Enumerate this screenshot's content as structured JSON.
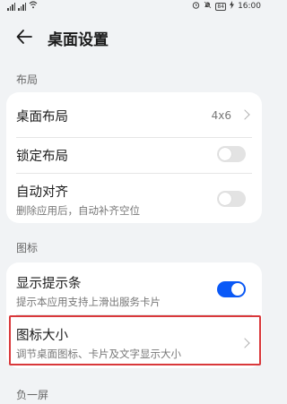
{
  "status_bar": {
    "time": "16:00",
    "battery": "84"
  },
  "header": {
    "title": "桌面设置"
  },
  "sections": {
    "layout": {
      "label": "布局",
      "items": [
        {
          "title": "桌面布局",
          "value": "4x6"
        },
        {
          "title": "锁定布局",
          "toggle": false
        },
        {
          "title": "自动对齐",
          "subtitle": "删除应用后，自动补齐空位",
          "toggle": false
        }
      ]
    },
    "icons": {
      "label": "图标",
      "items": [
        {
          "title": "显示提示条",
          "subtitle": "提示本应用支持上滑出服务卡片",
          "toggle": true
        },
        {
          "title": "图标大小",
          "subtitle": "调节桌面图标、卡片及文字显示大小"
        }
      ]
    },
    "minus_one": {
      "label": "负一屏"
    }
  },
  "colors": {
    "accent": "#0a59f7",
    "highlight": "#d9383b"
  }
}
